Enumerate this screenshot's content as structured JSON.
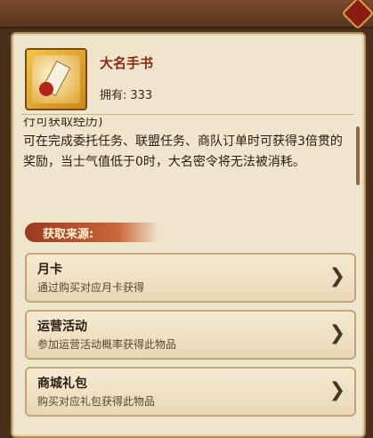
{
  "item": {
    "name": "大名手书",
    "owned_label": "拥有:",
    "owned_count": "333",
    "icon": "scroll-with-red-seal-icon"
  },
  "description": {
    "cut_line": "行可获取经历)",
    "text": "可在完成委托任务、联盟任务、商队订单时可获得3倍贯的奖励，当士气值低于0时，大名密令将无法被消耗。"
  },
  "sources": {
    "header": "获取来源:",
    "items": [
      {
        "title": "月卡",
        "desc": "通过购买对应月卡获得"
      },
      {
        "title": "运营活动",
        "desc": "参加运营活动概率获得此物品"
      },
      {
        "title": "商城礼包",
        "desc": "购买对应礼包获得此物品"
      }
    ]
  },
  "colors": {
    "panel_bg": "#efe4cc",
    "frame": "#4a2f1c",
    "accent_red": "#8a2a10",
    "band": "#c9683a"
  }
}
